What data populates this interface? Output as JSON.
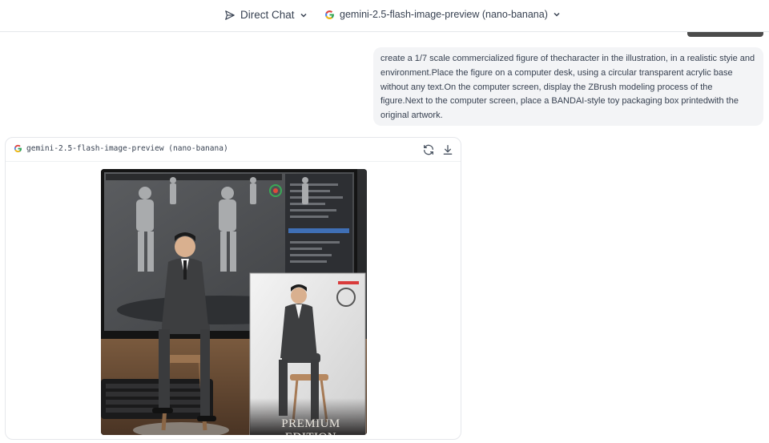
{
  "header": {
    "mode_label": "Direct Chat",
    "model_label": "gemini-2.5-flash-image-preview (nano-banana)"
  },
  "user_message": {
    "text": "create a 1/7 scale commercialized figure of thecharacter in the illustration, in a realistic styie and environment.Place the figure on a computer desk, using a circular transparent acrylic base without any text.On the computer screen, display the ZBrush modeling process of the figure.Next to the computer screen, place a BANDAI-style toy packaging box printedwith the original artwork."
  },
  "response": {
    "model_label": "gemini-2.5-flash-image-preview (nano-banana)",
    "image": {
      "box_title": "PREMIUM EDITION"
    }
  },
  "icons": {
    "mode": "send-icon",
    "mode_chevron": "chevron-down-icon",
    "model_logo": "google-logo-icon",
    "model_chevron": "chevron-down-icon",
    "regenerate": "refresh-icon",
    "download": "download-icon"
  },
  "colors": {
    "google_blue": "#4285F4",
    "google_red": "#EA4335",
    "google_yellow": "#FBBC05",
    "google_green": "#34A853",
    "bubble_bg": "#f3f4f6"
  }
}
